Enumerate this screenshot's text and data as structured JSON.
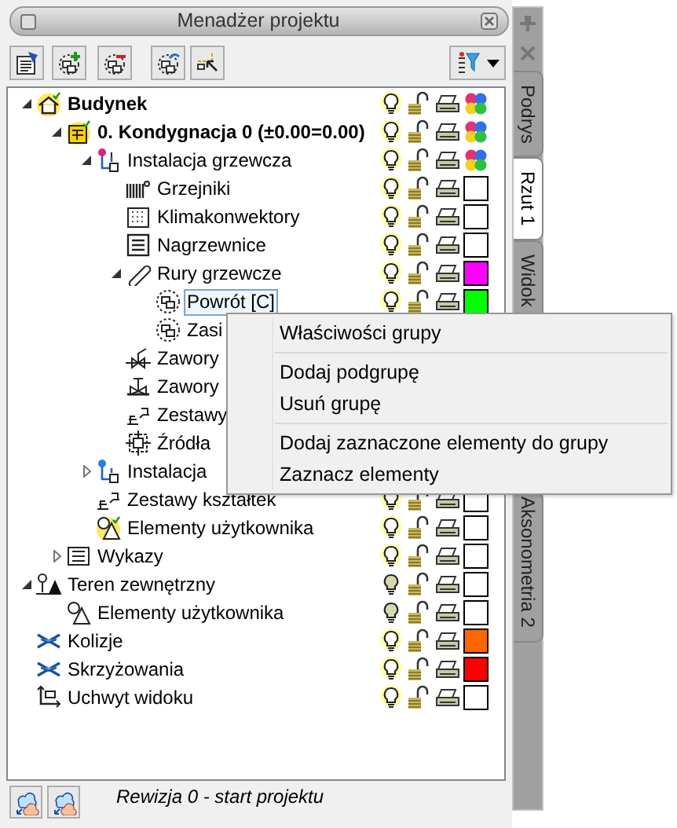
{
  "window": {
    "title": "Menadżer projektu"
  },
  "tree": [
    {
      "label": "Budynek",
      "kind": "building",
      "bold": true,
      "expanded": true,
      "selected": false,
      "light_on": true,
      "children": [
        {
          "label": "0. Kondygnacja 0 (±0.00=0.00)",
          "kind": "storey",
          "bold": true,
          "expanded": true,
          "selected": false,
          "light_on": true,
          "children": [
            {
              "label": "Instalacja grzewcza",
              "kind": "installation",
              "bold": false,
              "expanded": true,
              "selected": false,
              "light_on": true,
              "children": [
                {
                  "label": "Grzejniki",
                  "kind": "radiator",
                  "bold": false,
                  "selected": false,
                  "light_on": true,
                  "color": "#ffffff"
                },
                {
                  "label": "Klimakonwektory",
                  "kind": "convector",
                  "bold": false,
                  "selected": false,
                  "light_on": true,
                  "color": "#ffffff"
                },
                {
                  "label": "Nagrzewnice",
                  "kind": "heater",
                  "bold": false,
                  "selected": false,
                  "light_on": true,
                  "color": "#ffffff"
                },
                {
                  "label": "Rury grzewcze",
                  "kind": "pipe",
                  "bold": false,
                  "expanded": true,
                  "selected": false,
                  "light_on": true,
                  "color": "#ff00ff",
                  "children": [
                    {
                      "label": "Powrót [C]",
                      "kind": "group",
                      "bold": false,
                      "selected": true,
                      "light_on": true,
                      "color": "#00ff00"
                    },
                    {
                      "label": "Zasi",
                      "kind": "group",
                      "bold": false,
                      "selected": false
                    }
                  ]
                },
                {
                  "label": "Zawory",
                  "kind": "valve",
                  "bold": false,
                  "selected": false
                },
                {
                  "label": "Zawory",
                  "kind": "valve2",
                  "bold": false,
                  "selected": false
                },
                {
                  "label": "Zestawy",
                  "kind": "fittings",
                  "bold": false,
                  "selected": false
                },
                {
                  "label": "Źródła",
                  "kind": "source",
                  "bold": false,
                  "selected": false
                }
              ]
            },
            {
              "label": "Instalacja",
              "kind": "installation2",
              "bold": false,
              "expanded": false,
              "selected": false
            },
            {
              "label": "Zestawy kształtek",
              "kind": "fittings",
              "bold": false,
              "selected": false,
              "light_on": true,
              "color": "#ffffff"
            },
            {
              "label": "Elementy użytkownika",
              "kind": "user",
              "bold": false,
              "selected": false,
              "light_on": true,
              "color": "#ffffff"
            }
          ]
        },
        {
          "label": "Wykazy",
          "kind": "list",
          "bold": false,
          "expanded": false,
          "selected": false,
          "light_on": true,
          "color": "#ffffff"
        }
      ]
    },
    {
      "label": "Teren zewnętrzny",
      "kind": "terrain",
      "bold": false,
      "expanded": true,
      "selected": false,
      "light_on": false,
      "color": "#ffffff",
      "children": [
        {
          "label": "Elementy użytkownika",
          "kind": "user2",
          "bold": false,
          "selected": false,
          "light_on": false,
          "color": "#ffffff"
        }
      ]
    },
    {
      "label": "Kolizje",
      "kind": "collision",
      "bold": false,
      "selected": false,
      "light_on": true,
      "color": "#ff6600"
    },
    {
      "label": "Skrzyżowania",
      "kind": "collision",
      "bold": false,
      "selected": false,
      "light_on": true,
      "color": "#ff0000"
    },
    {
      "label": "Uchwyt widoku",
      "kind": "handle",
      "bold": false,
      "selected": false,
      "light_on": true,
      "color": "#ffffff"
    }
  ],
  "context_menu": [
    {
      "kind": "item",
      "label": "Właściwości grupy"
    },
    {
      "kind": "separator"
    },
    {
      "kind": "item",
      "label": "Dodaj podgrupę"
    },
    {
      "kind": "item",
      "label": "Usuń grupę"
    },
    {
      "kind": "separator"
    },
    {
      "kind": "item",
      "label": "Dodaj zaznaczone elementy do grupy"
    },
    {
      "kind": "item",
      "label": "Zaznacz elementy"
    }
  ],
  "status": "Rewizja 0 - start projektu",
  "side_tabs": [
    {
      "label": "Podrys",
      "selected": false
    },
    {
      "label": "Rzut 1",
      "selected": true
    },
    {
      "label": "Widok",
      "selected": false
    },
    {
      "label": "Aksonometria 2",
      "selected": false
    }
  ]
}
